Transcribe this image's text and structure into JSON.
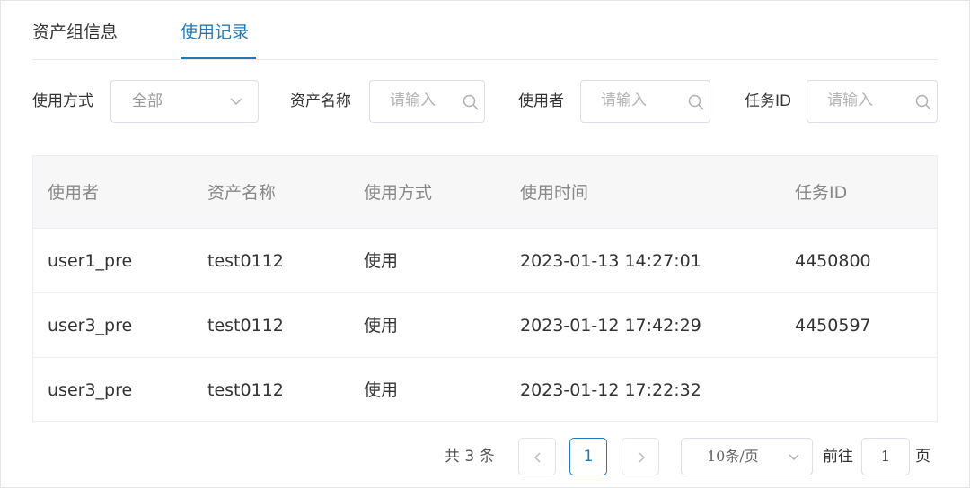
{
  "tabs": [
    {
      "label": "资产组信息",
      "active": false
    },
    {
      "label": "使用记录",
      "active": true
    }
  ],
  "filters": {
    "usage_type": {
      "label": "使用方式",
      "value": "全部"
    },
    "asset_name": {
      "label": "资产名称",
      "placeholder": "请输入"
    },
    "user": {
      "label": "使用者",
      "placeholder": "请输入"
    },
    "task_id": {
      "label": "任务ID",
      "placeholder": "请输入"
    }
  },
  "table": {
    "columns": [
      "使用者",
      "资产名称",
      "使用方式",
      "使用时间",
      "任务ID"
    ],
    "rows": [
      [
        "user1_pre",
        "test0112",
        "使用",
        "2023-01-13 14:27:01",
        "4450800"
      ],
      [
        "user3_pre",
        "test0112",
        "使用",
        "2023-01-12 17:42:29",
        "4450597"
      ],
      [
        "user3_pre",
        "test0112",
        "使用",
        "2023-01-12 17:22:32",
        ""
      ]
    ]
  },
  "pagination": {
    "total_text": "共 3 条",
    "current_page": "1",
    "page_size": "10条/页",
    "goto_label": "前往",
    "goto_value": "1",
    "page_suffix": "页"
  },
  "colors": {
    "accent": "#1f7ab8",
    "header_bg": "#f7f7f7",
    "border": "#e6e6e6"
  },
  "icons": {
    "dropdown": "chevron-down-icon",
    "search": "search-icon",
    "prev": "chevron-left-icon",
    "next": "chevron-right-icon"
  }
}
